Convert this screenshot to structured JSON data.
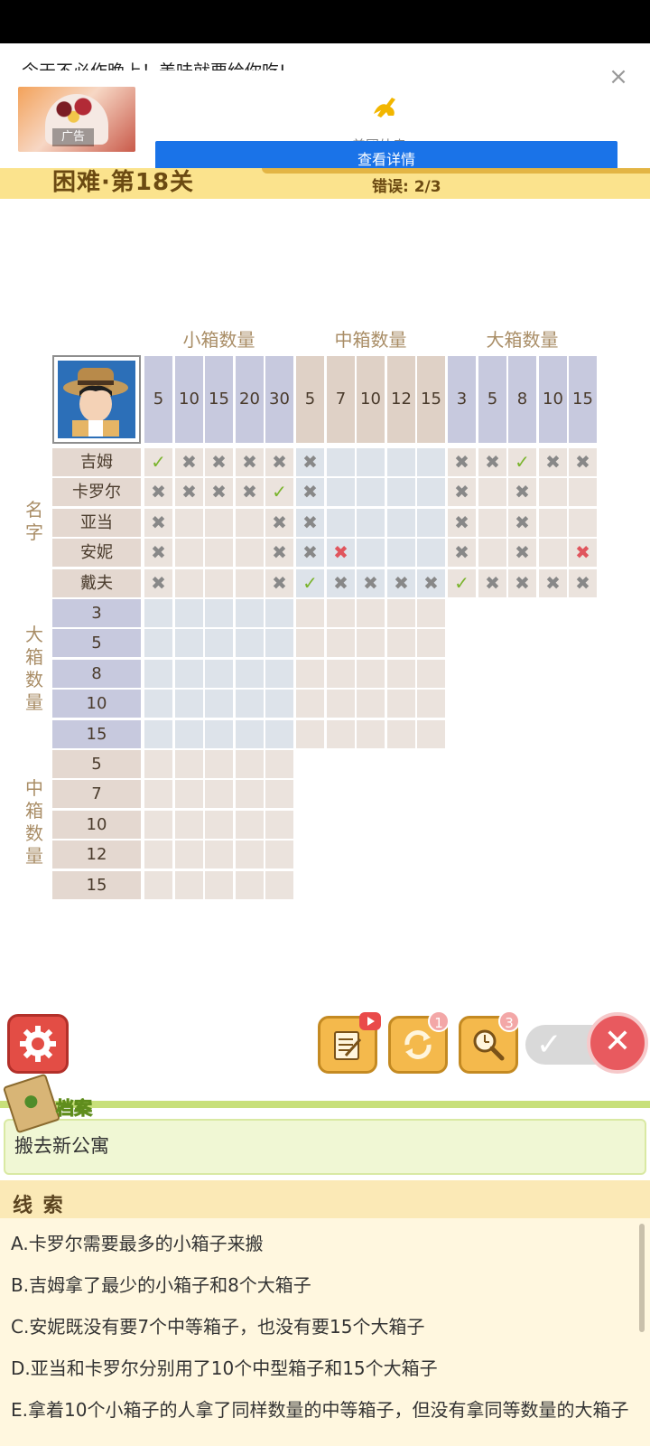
{
  "ad": {
    "top_text": "今天不必作晚上！美味就要给你吃!",
    "close_symbol": "×",
    "tag": "广告",
    "brand": "美团外卖",
    "button_label": "查看详情"
  },
  "level": {
    "title": "困难·第18关",
    "errors": "错误: 2/3"
  },
  "grid": {
    "group_headers": [
      "小箱数量",
      "中箱数量",
      "大箱数量"
    ],
    "small_counts": [
      "5",
      "10",
      "15",
      "20",
      "30"
    ],
    "medium_counts": [
      "5",
      "7",
      "10",
      "12",
      "15"
    ],
    "large_counts": [
      "3",
      "5",
      "8",
      "10",
      "15"
    ],
    "side_labels": {
      "names": "名字",
      "large": "大箱数量",
      "medium": "中箱数量"
    },
    "names": [
      "吉姆",
      "卡罗尔",
      "亚当",
      "安妮",
      "戴夫"
    ],
    "large_rows": [
      "3",
      "5",
      "8",
      "10",
      "15"
    ],
    "medium_rows": [
      "5",
      "7",
      "10",
      "12",
      "15"
    ],
    "marks": {
      "吉姆": [
        "ck",
        "xg",
        "xg",
        "xg",
        "xg",
        "xg",
        "",
        "",
        "",
        "",
        "xg",
        "xg",
        "ck",
        "xg",
        "xg"
      ],
      "卡罗尔": [
        "xg",
        "xg",
        "xg",
        "xg",
        "ck",
        "xg",
        "",
        "",
        "",
        "",
        "xg",
        "",
        "xg",
        "",
        ""
      ],
      "亚当": [
        "xg",
        "",
        "",
        "",
        "xg",
        "xg",
        "",
        "",
        "",
        "",
        "xg",
        "",
        "xg",
        "",
        ""
      ],
      "安妮": [
        "xg",
        "",
        "",
        "",
        "xg",
        "xg",
        "xr",
        "",
        "",
        "",
        "xg",
        "",
        "xg",
        "",
        "xr"
      ],
      "戴夫": [
        "xg",
        "",
        "",
        "",
        "xg",
        "ck",
        "xg",
        "xg",
        "xg",
        "xg",
        "ck",
        "xg",
        "xg",
        "xg",
        "xg"
      ]
    },
    "mark_symbols": {
      "ck": "✓",
      "xg": "✖",
      "xr": "✖"
    }
  },
  "toolbar": {
    "settings_icon": "gear-icon",
    "notes_icon": "notebook-video-icon",
    "refresh_icon": "refresh-icon",
    "refresh_badge": "1",
    "hint_icon": "magnifier-clock-icon",
    "hint_badge": "3",
    "toggle_check": "✓",
    "toggle_x": "✕"
  },
  "archive": {
    "label": "档案",
    "text": "搬去新公寓"
  },
  "clues": {
    "title": "线 索",
    "items": [
      "A.卡罗尔需要最多的小箱子来搬",
      "B.吉姆拿了最少的小箱子和8个大箱子",
      "C.安妮既没有要7个中等箱子，也没有要15个大箱子",
      "D.亚当和卡罗尔分别用了10个中型箱子和15个大箱子",
      "E.拿着10个小箱子的人拿了同样数量的中等箱子，但没有拿同等数量的大箱子"
    ]
  },
  "colors": {
    "small_col": "#c7c9de",
    "medium_col": "#dfd1c6",
    "large_col": "#c7c9de",
    "label_col": "#e4d8d0",
    "blue_cell": "#dde3ea",
    "tan_cell": "#ebe3dd"
  }
}
